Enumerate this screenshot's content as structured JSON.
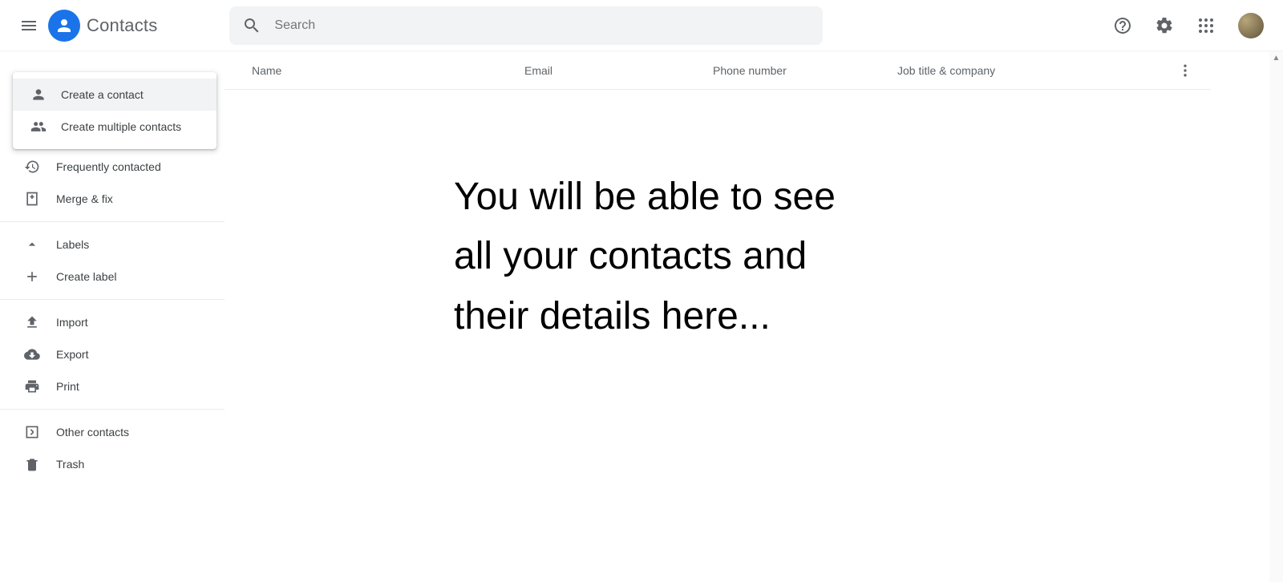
{
  "header": {
    "app_title": "Contacts",
    "search_placeholder": "Search"
  },
  "dropdown": {
    "items": [
      {
        "label": "Create a contact"
      },
      {
        "label": "Create multiple contacts"
      }
    ]
  },
  "sidebar": {
    "frequently": "Frequently contacted",
    "merge": "Merge & fix",
    "labels_header": "Labels",
    "create_label": "Create label",
    "import": "Import",
    "export": "Export",
    "print": "Print",
    "other": "Other contacts",
    "trash": "Trash"
  },
  "columns": {
    "name": "Name",
    "email": "Email",
    "phone": "Phone number",
    "job": "Job title & company"
  },
  "annotation": {
    "line1": "You will be able to see",
    "line2": "all your contacts and",
    "line3": "their details here..."
  }
}
